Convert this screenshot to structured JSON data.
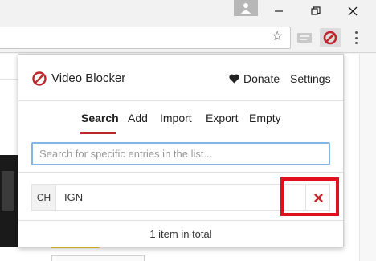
{
  "popup": {
    "title": "Video Blocker",
    "donate_label": "Donate",
    "settings_label": "Settings",
    "tabs": [
      {
        "label": "Search",
        "active": true
      },
      {
        "label": "Add",
        "active": false
      },
      {
        "label": "Import",
        "active": false
      },
      {
        "label": "Export",
        "active": false
      },
      {
        "label": "Empty",
        "active": false
      }
    ],
    "search": {
      "value": "",
      "placeholder": "Search for specific entries in the list..."
    },
    "entries": [
      {
        "type": "CH",
        "value": "IGN"
      }
    ],
    "footer_text": "1 item in total"
  },
  "colors": {
    "accent_red": "#c0272d",
    "input_focus_border": "#86b4e4",
    "highlight_box": "#e0101e"
  },
  "icons": [
    "user-icon",
    "minimize-icon",
    "maximize-icon",
    "close-icon",
    "star-icon",
    "extension-icon",
    "video-blocker-icon",
    "menu-icon",
    "heart-icon",
    "delete-x-icon"
  ]
}
